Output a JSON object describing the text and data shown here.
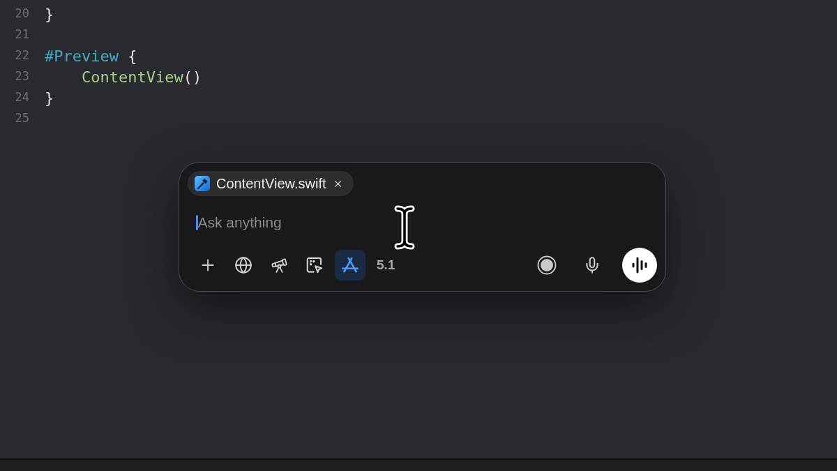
{
  "editor": {
    "lines": [
      {
        "number": "20",
        "tokens": [
          {
            "text": "}",
            "kind": "plain"
          }
        ]
      },
      {
        "number": "21"
      },
      {
        "number": "22",
        "tokens": [
          {
            "text": "#Preview",
            "kind": "keyword"
          },
          {
            "text": " {",
            "kind": "plain"
          }
        ]
      },
      {
        "number": "23",
        "tokens": [
          {
            "text": "    ContentView",
            "kind": "type"
          },
          {
            "text": "()",
            "kind": "plain"
          }
        ]
      },
      {
        "number": "24",
        "tokens": [
          {
            "text": "}",
            "kind": "plain"
          }
        ]
      },
      {
        "number": "25"
      }
    ]
  },
  "composer": {
    "attachments": [
      {
        "name": "ContentView.swift"
      }
    ],
    "input": {
      "placeholder": "Ask anything",
      "focused": true
    },
    "tools": [
      {
        "selected": false
      },
      {
        "selected": false
      },
      {
        "selected": false
      },
      {
        "selected": false
      },
      {
        "selected": true
      }
    ],
    "model": "5.1"
  }
}
